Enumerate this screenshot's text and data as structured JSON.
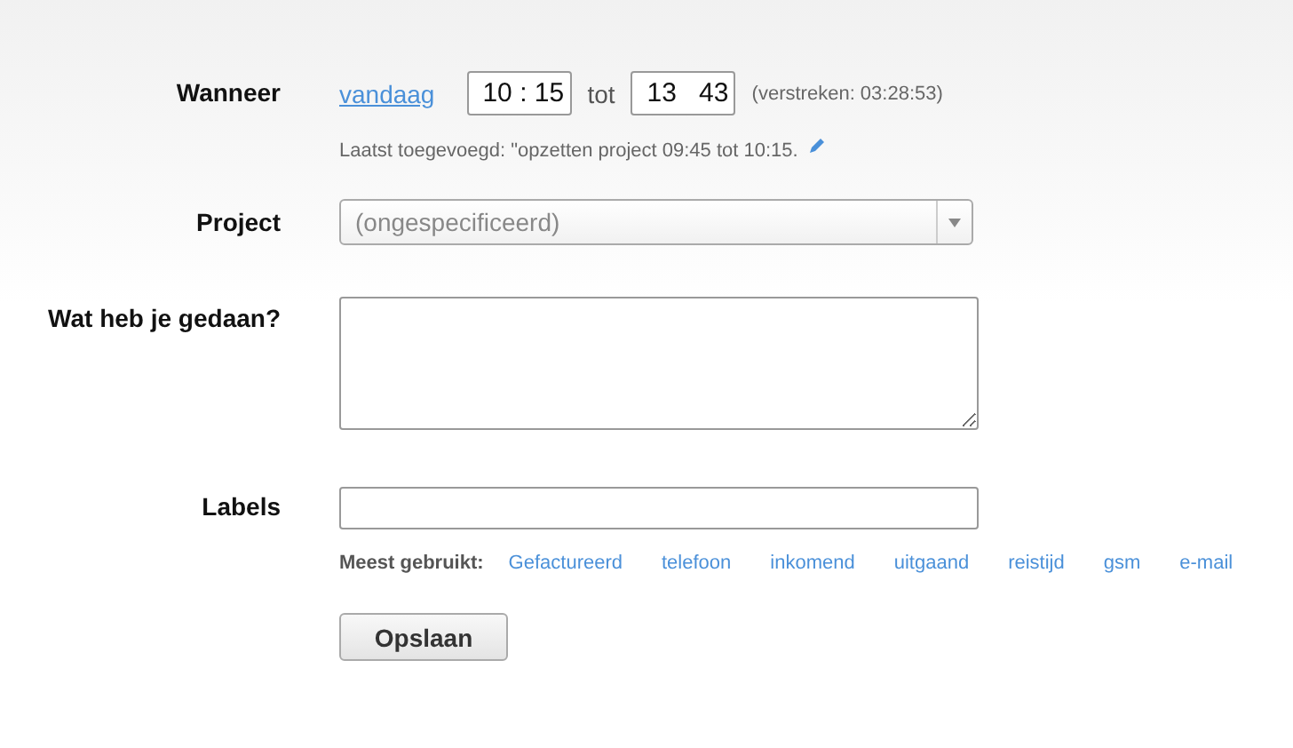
{
  "when": {
    "label": "Wanneer",
    "day_link": "vandaag",
    "from": "10 : 15",
    "separator": "tot",
    "to": "13   43",
    "elapsed": "(verstreken: 03:28:53)",
    "last_added": "Laatst toegevoegd: \"opzetten project 09:45 tot 10:15."
  },
  "project": {
    "label": "Project",
    "placeholder": "(ongespecificeerd)"
  },
  "description": {
    "label": "Wat heb je gedaan?"
  },
  "labels": {
    "label": "Labels",
    "most_used_label": "Meest gebruikt:",
    "suggestions": [
      "Gefactureerd",
      "telefoon",
      "inkomend",
      "uitgaand",
      "reistijd",
      "gsm",
      "e-mail"
    ]
  },
  "save_button": "Opslaan"
}
